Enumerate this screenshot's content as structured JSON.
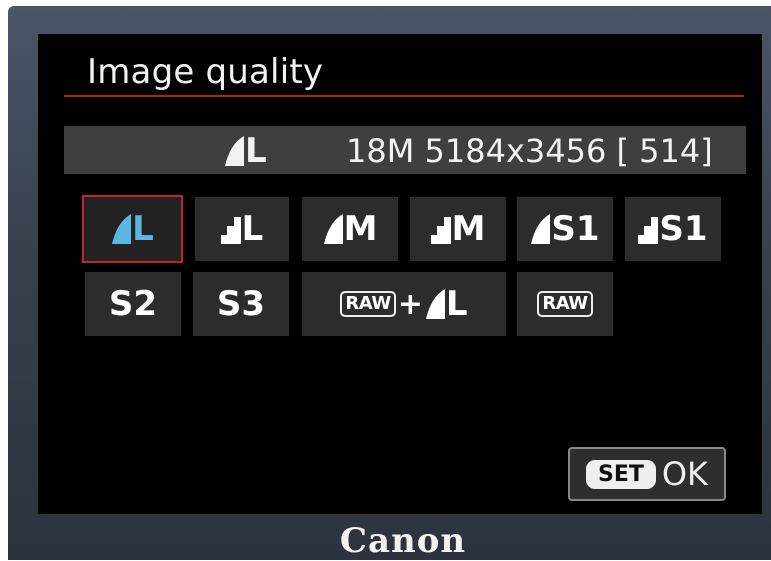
{
  "screen": {
    "title": "Image quality",
    "info": {
      "icon": "fine-quality-icon",
      "letter": "L",
      "summary": "18M 5184x3456 [ 514]"
    }
  },
  "options": [
    {
      "id": "fine-large",
      "icon": "fine-quality-icon",
      "label": "L",
      "selected": true
    },
    {
      "id": "normal-large",
      "icon": "normal-quality-icon",
      "label": "L"
    },
    {
      "id": "fine-medium",
      "icon": "fine-quality-icon",
      "label": "M"
    },
    {
      "id": "normal-medium",
      "icon": "normal-quality-icon",
      "label": "M"
    },
    {
      "id": "fine-s1",
      "icon": "fine-quality-icon",
      "label": "S1"
    },
    {
      "id": "normal-s1",
      "icon": "normal-quality-icon",
      "label": "S1"
    },
    {
      "id": "s2",
      "label": "S2"
    },
    {
      "id": "s3",
      "label": "S3"
    },
    {
      "id": "raw-plus-fine-large",
      "raw_label": "RAW",
      "plus": "+",
      "icon": "fine-quality-icon",
      "label": "L"
    },
    {
      "id": "raw",
      "raw_label": "RAW"
    }
  ],
  "footer": {
    "set_label": "SET",
    "ok_label": "OK"
  },
  "brand": "Canon",
  "colors": {
    "selection_border": "#c0252c",
    "selection_text": "#5ab8e0",
    "title_rule": "#b31e2a",
    "cell_bg": "#2c2c2c",
    "info_bar_bg": "#3f3f3f"
  }
}
